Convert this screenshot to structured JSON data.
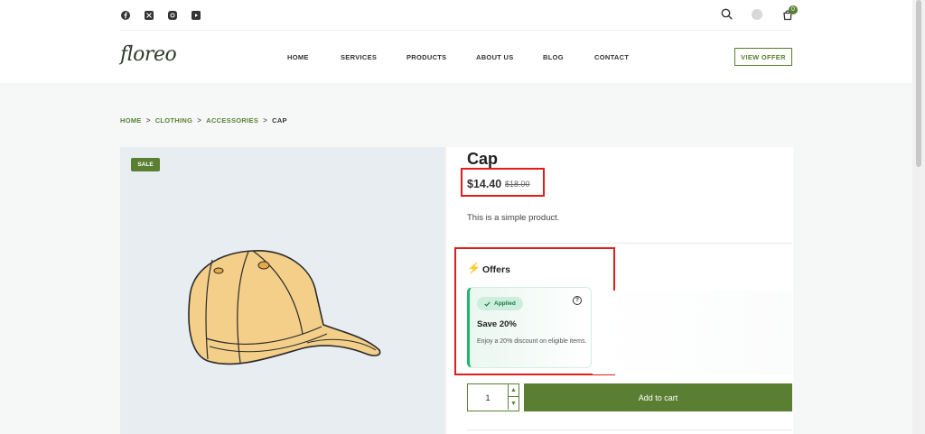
{
  "topbar": {
    "social": [
      "facebook-icon",
      "x-icon",
      "instagram-icon",
      "youtube-icon"
    ],
    "cart_count": "0"
  },
  "header": {
    "logo": "floreo",
    "menu": [
      "HOME",
      "SERVICES",
      "PRODUCTS",
      "ABOUT US",
      "BLOG",
      "CONTACT"
    ],
    "cta": "VIEW OFFER"
  },
  "breadcrumb": {
    "items": [
      "HOME",
      "CLOTHING",
      "ACCESSORIES"
    ],
    "current": "CAP",
    "separator": ">"
  },
  "product": {
    "badge": "SALE",
    "title": "Cap",
    "price": "$14.40",
    "old_price": "$18.00",
    "short_description": "This is a simple product."
  },
  "offers": {
    "title": "Offers",
    "card": {
      "status": "Applied",
      "help": "?",
      "title": "Save 20%",
      "description": "Enjoy a 20% discount on eligible items."
    }
  },
  "cart_form": {
    "quantity": "1",
    "add_label": "Add to cart"
  },
  "colors": {
    "brand": "#5a7f33",
    "highlight": "#e31b1b",
    "offer_accent": "#1db86a"
  }
}
